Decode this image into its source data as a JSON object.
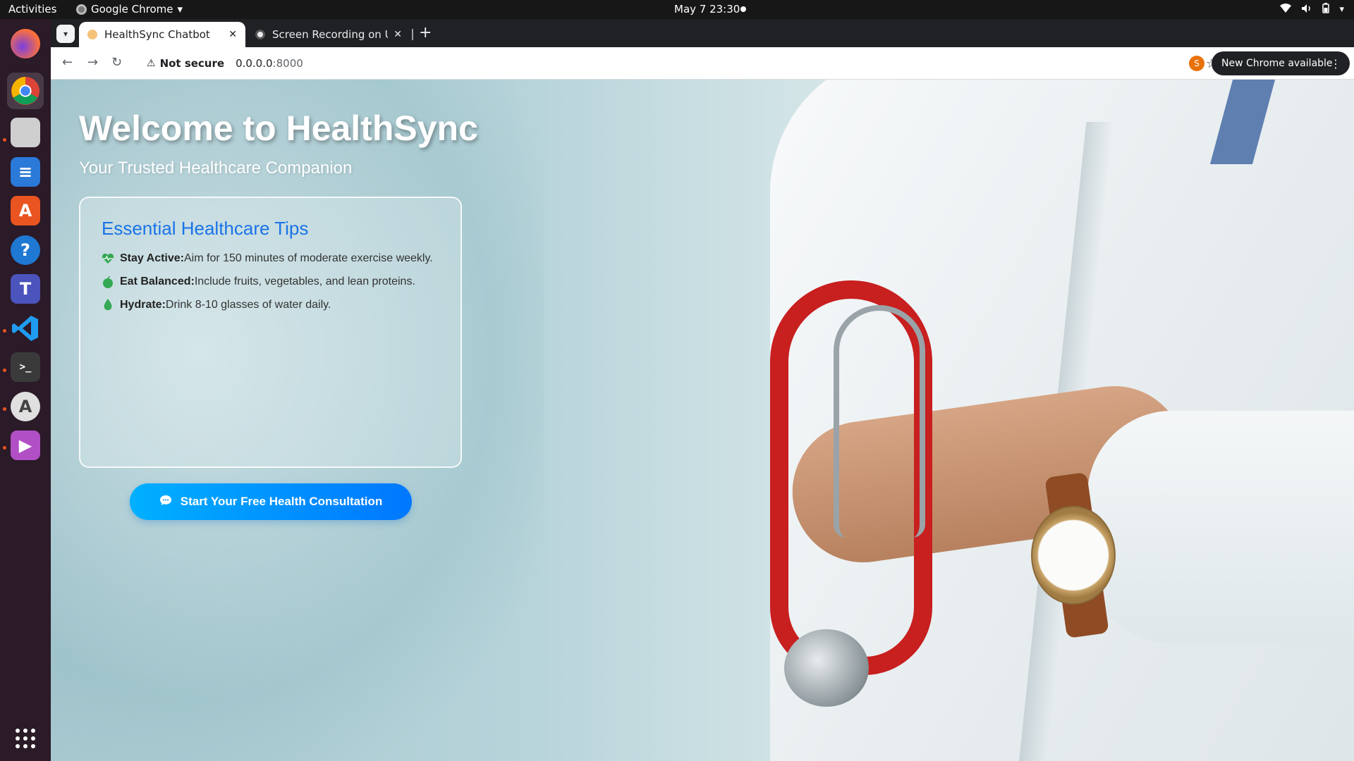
{
  "system": {
    "activities": "Activities",
    "app_name": "Google Chrome",
    "clock": "May 7  23:30"
  },
  "dock": {
    "apps": [
      "firefox",
      "chrome",
      "files",
      "writer",
      "app-center",
      "help",
      "teams-linux",
      "vscode",
      "terminal",
      "software-updater",
      "media-player",
      "show-apps"
    ]
  },
  "browser": {
    "tabs": [
      {
        "title": "HealthSync Chatbot",
        "active": true
      },
      {
        "title": "Screen Recording on Ubuntu",
        "active": false
      }
    ],
    "new_tab": "+",
    "security_label": "Not secure",
    "url_host": "0.0.0.0",
    "url_port": ":8000",
    "profile_initial": "S",
    "update_label": "New Chrome available"
  },
  "page": {
    "title": "Welcome to HealthSync",
    "subtitle": "Your Trusted Healthcare Companion",
    "tips": {
      "heading": "Essential Healthcare Tips",
      "items": [
        {
          "label": "Stay Active:",
          "text": "Aim for 150 minutes of moderate exercise weekly.",
          "icon": "heartbeat-icon"
        },
        {
          "label": "Eat Balanced:",
          "text": "Include fruits, vegetables, and lean proteins.",
          "icon": "apple-icon"
        },
        {
          "label": "Hydrate:",
          "text": "Drink 8-10 glasses of water daily.",
          "icon": "droplet-icon"
        }
      ]
    },
    "cta_label": "Start Your Free Health Consultation",
    "colors": {
      "accent": "#1a73e8",
      "cta_start": "#00b0ff",
      "cta_end": "#0077ff",
      "tip_icon": "#34a853"
    }
  }
}
